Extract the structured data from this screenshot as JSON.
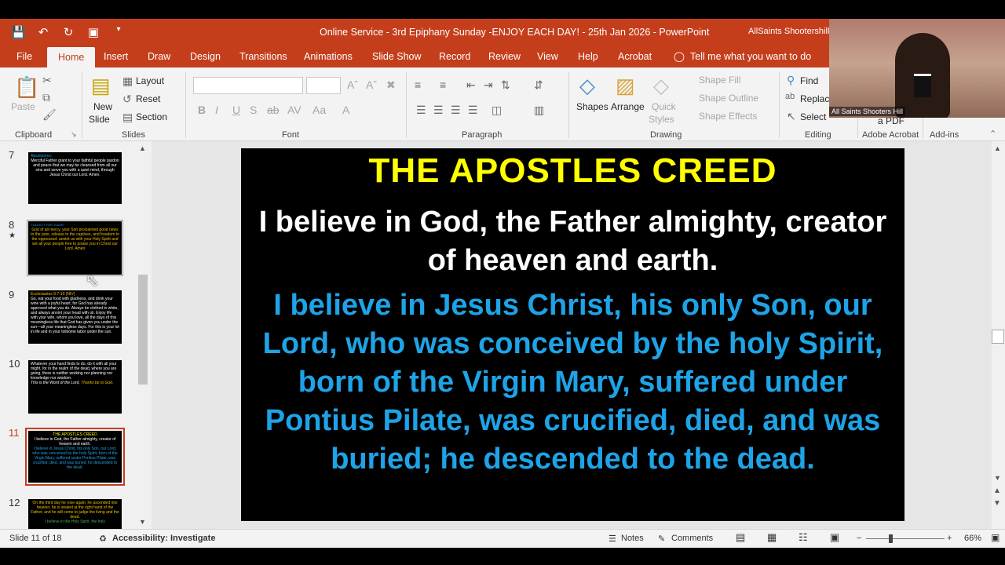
{
  "titlebar": {
    "doc_title": "Online Service - 3rd Epiphany Sunday -ENJOY EACH DAY! - 25th Jan 2026  -  PowerPoint",
    "account": "AllSaints Shootershill"
  },
  "tabs": [
    "File",
    "Home",
    "Insert",
    "Draw",
    "Design",
    "Transitions",
    "Animations",
    "Slide Show",
    "Record",
    "Review",
    "View",
    "Help",
    "Acrobat"
  ],
  "tell_me": "Tell me what you want to do",
  "ribbon": {
    "clipboard": {
      "paste": "Paste",
      "label": "Clipboard"
    },
    "slides": {
      "new_slide": "New",
      "new_slide2": "Slide",
      "layout": "Layout",
      "reset": "Reset",
      "section": "Section",
      "label": "Slides"
    },
    "font": {
      "label": "Font"
    },
    "paragraph": {
      "label": "Paragraph"
    },
    "drawing": {
      "shapes": "Shapes",
      "arrange": "Arrange",
      "quick_styles": "Quick",
      "quick_styles2": "Styles",
      "shape_fill": "Shape Fill",
      "shape_outline": "Shape Outline",
      "shape_effects": "Shape Effects",
      "label": "Drawing"
    },
    "editing": {
      "find": "Find",
      "replace": "Replace",
      "select": "Select",
      "label": "Editing"
    },
    "adobe": {
      "pdf": "a PDF",
      "label": "Adobe Acrobat"
    },
    "addins": {
      "label": "Add-ins"
    }
  },
  "thumbnails": [
    {
      "num": "7",
      "title": "Absolutions:",
      "text": "Merciful Father grant to your faithful people pardon and peace that we may be cleansed from all our sins and serve you with a quiet mind, through Jesus Christ our Lord. Amen."
    },
    {
      "num": "8",
      "title": "COLLECT FOR TODAY",
      "text": "God of all mercy, your Son proclaimed good news to the poor, release to the captives, and freedom to the oppressed: anoint us with your Holy Spirit and set all your people free to praise you in Christ our Lord. Amen"
    },
    {
      "num": "9",
      "title": "Ecclesiastes 9:7-10 (NIV)",
      "text": "Go, eat your food with gladness, and drink your wine with a joyful heart, for God has already approved what you do. Always be clothed in white, and always anoint your head with oil. Enjoy life with your wife, whom you love, all the days of this meaningless life that God has given you under the sun—all your meaningless days. For this is your lot in life and in your toilsome labor under the sun."
    },
    {
      "num": "10",
      "title": "",
      "text": "Whatever your hand finds to do, do it with all your might, for in the realm of the dead, where you are going, there is neither working nor planning nor knowledge nor wisdom.",
      "footer": "This is the Word of the Lord, ",
      "footer2": "Thanks be to God."
    },
    {
      "num": "11",
      "title": "THE APOSTLES CREED",
      "text": "I believe in God, the Father almighty, creator of heaven and earth.",
      "text2": "I believe in Jesus Christ, his only Son, our Lord, who was conceived by the holy Spirit, born of the Virgin Mary, suffered under Pontius Pilate, was crucified, died, and was buried; he descended to the dead."
    },
    {
      "num": "12",
      "title": "",
      "text": "On the third day he rose again; he ascended into heaven, he is seated at the right hand of the Father, and he will come to judge the living and the dead.",
      "text2": "I believe in the Holy Spirit, the holy"
    }
  ],
  "slide": {
    "title": "THE APOSTLES CREED",
    "para1": "I believe in God, the Father almighty, creator of heaven and earth.",
    "para2": "I believe in Jesus Christ, his only Son, our Lord, who was conceived by the holy Spirit, born of the Virgin Mary, suffered under Pontius Pilate, was crucified, died, and was buried; he descended to the dead.",
    "colors": {
      "title": "#ffff00",
      "para1": "#ffffff",
      "para2": "#1ea3e6"
    }
  },
  "status": {
    "slide_of": "Slide 11 of 18",
    "accessibility": "Accessibility: Investigate",
    "notes": "Notes",
    "comments": "Comments",
    "zoom": "66%"
  },
  "webcam": {
    "label": "All Saints Shooters Hill"
  },
  "accent": "#c43e1c"
}
